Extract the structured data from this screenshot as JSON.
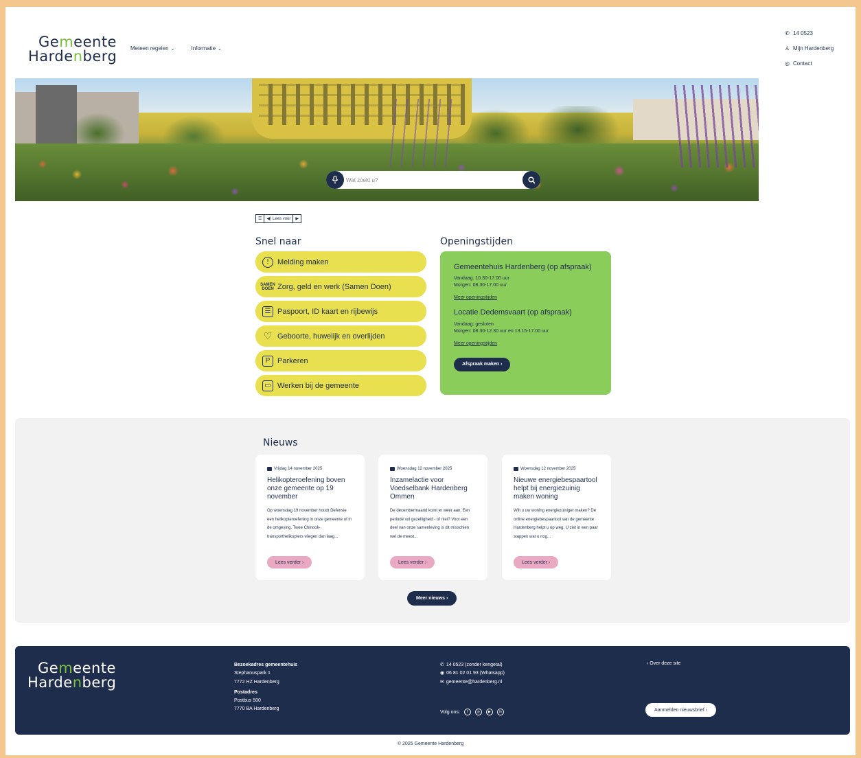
{
  "header": {
    "logo_line1_a": "Ge",
    "logo_line1_w": "m",
    "logo_line1_b": "eente",
    "logo_line2_a": "Harde",
    "logo_line2_w": "n",
    "logo_line2_b": "berg",
    "nav": [
      {
        "label": "Meteen regelen"
      },
      {
        "label": "Informatie"
      }
    ],
    "utility": [
      {
        "icon": "phone-icon",
        "label": "14 0523"
      },
      {
        "icon": "user-icon",
        "label": "Mijn Hardenberg"
      },
      {
        "icon": "contact-icon",
        "label": "Contact"
      }
    ]
  },
  "search": {
    "placeholder": "Wat zoekt u?"
  },
  "readaloud": {
    "label": "Lees voor"
  },
  "quick": {
    "title": "Snel naar",
    "items": [
      {
        "icon": "alert-icon",
        "label": "Melding maken"
      },
      {
        "icon": "samen-doen-icon",
        "icon_text": "SAMEN DOEN",
        "label": "Zorg, geld en werk (Samen Doen)"
      },
      {
        "icon": "id-card-icon",
        "label": "Paspoort, ID kaart en rijbewijs"
      },
      {
        "icon": "heart-icon",
        "label": "Geboorte, huwelijk en overlijden"
      },
      {
        "icon": "parking-icon",
        "label": "Parkeren"
      },
      {
        "icon": "briefcase-icon",
        "label": "Werken bij de gemeente"
      }
    ]
  },
  "hours": {
    "title": "Openingstijden",
    "loc1": {
      "name": "Gemeentehuis Hardenberg (op afspraak)",
      "today": "Vandaag: 10.30-17.00 uur",
      "tomorrow": "Morgen: 08.30-17.00 uur",
      "more": "Meer openingstijden"
    },
    "loc2": {
      "name": "Locatie Dedemsvaart (op afspraak)",
      "today": "Vandaag: gesloten",
      "tomorrow": "Morgen: 08.30-12.30 uur en 13.15-17.00 uur",
      "more": "Meer openingstijden"
    },
    "button": "Afspraak maken ›"
  },
  "news": {
    "title": "Nieuws",
    "items": [
      {
        "date": "Vrijdag 14 november 2025",
        "title": "Helikopteroefening boven onze gemeente op 19 november",
        "body": "Op woensdag 19 november houdt Defensie een helikopteroefening in onze gemeente of in de omgeving. Twee Chinook-transporthelikopters vliegen dan laag...",
        "button": "Lees verder ›"
      },
      {
        "date": "Woensdag 12 november 2025",
        "title": "Inzamelactie voor Voedselbank Hardenberg Ommen",
        "body": "De decembermaand komt er weer aan. Een periode vol gezelligheid - of niet? Voor een deel van onze samenleving is dit misschien wel de meest...",
        "button": "Lees verder ›"
      },
      {
        "date": "Woensdag 12 november 2025",
        "title": "Nieuwe energiebespaartool helpt bij energiezuinig maken woning",
        "body": "Wilt u uw woning energiezuiniger maken? De online energiebespaartool van de gemeente Hardenberg helpt u op weg. U ziet in een paar stappen wat u nog...",
        "button": "Lees verder ›"
      }
    ],
    "more": "Meer nieuws ›"
  },
  "footer": {
    "visit_title": "Bezoekadres gemeentehuis",
    "visit_street": "Stephanuspark 1",
    "visit_city": "7772 HZ Hardenberg",
    "post_title": "Postadres",
    "post_box": "Postbus 500",
    "post_city": "7770 BA Hardenberg",
    "phone": "14 0523 (zonder kengetal)",
    "whatsapp": "06 81 02 01 93 (Whatsapp)",
    "email": "gemeente@hardenberg.nl",
    "follow": "Volg ons:",
    "about": "› Over deze site",
    "newsletter": "Aanmelden nieuwsbrief ›",
    "copyright": "© 2025 Gemeente Hardenberg"
  },
  "colors": {
    "brand_navy": "#1f2d4d",
    "brand_green": "#78bf3b",
    "quick_yellow": "#e9e04f",
    "hours_green": "#8acd5b",
    "news_pink": "#eaa9c3",
    "frame_orange": "#f4c78e"
  }
}
